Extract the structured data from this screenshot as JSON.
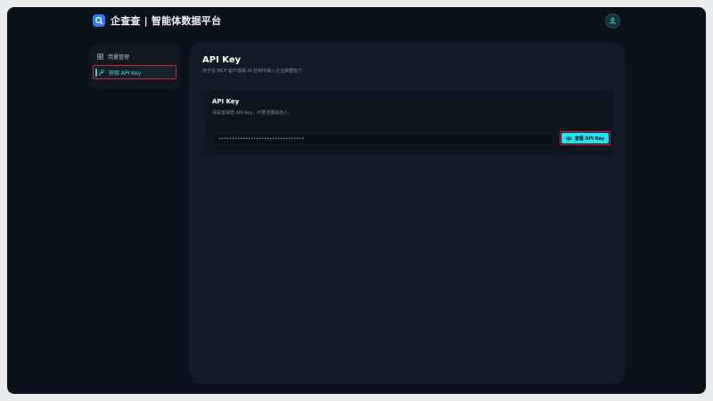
{
  "app": {
    "title": "企查查 | 智能体数据平台"
  },
  "header": {
    "avatar_icon": "user-icon"
  },
  "sidebar": {
    "items": [
      {
        "label": "用量管理",
        "icon": "grid-icon"
      },
      {
        "label": "获取 API Key",
        "icon": "key-icon",
        "active": true
      }
    ]
  },
  "main": {
    "title": "API Key",
    "subtitle": "用于在 MCP 客户端或 AI 应用中接入企业数据能力",
    "card": {
      "title": "API Key",
      "description": "请妥善保管 API Key，不要泄露给他人。",
      "masked_key": "••••••••••••••••••••••••••••••••",
      "view_button_label": "查看 API Key",
      "view_button_icon": "eye-icon"
    }
  },
  "colors": {
    "accent": "#26e0ef",
    "highlight_border": "#d0253a",
    "background": "#0b111a",
    "panel": "#121a25"
  }
}
